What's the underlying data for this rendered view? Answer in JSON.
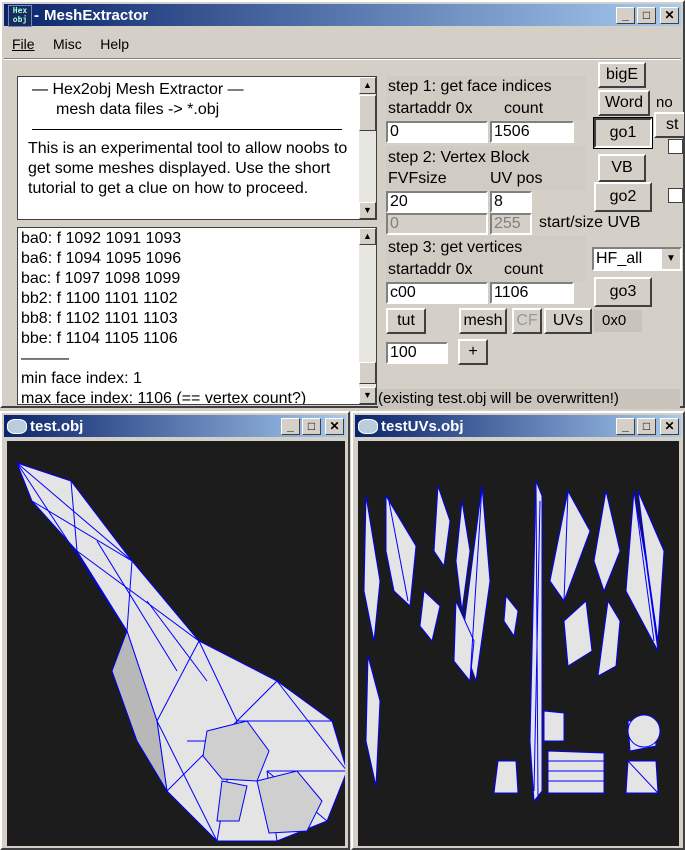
{
  "app": {
    "title": "MeshExtractor",
    "title_prefix": "- ",
    "icon_text_1": "Hex",
    "icon_text_2": "obj"
  },
  "menu": [
    "File",
    "Misc",
    "Help"
  ],
  "info": {
    "line1": "—   Hex2obj Mesh Extractor   —",
    "line2": "mesh data files -> *.obj",
    "para": "This is an experimental tool to allow noobs to get some meshes displayed. Use the short tutorial to get a clue on how to proceed."
  },
  "log": {
    "lines": [
      "ba0: f  1092 1091 1093",
      "ba6: f  1094 1095 1096",
      "bac: f  1097 1098 1099",
      "bb2: f  1100 1101 1102",
      "bb8: f  1102 1101 1103",
      "bbe: f  1104 1105 1106",
      "———",
      "min face index: 1",
      "max face index: 1106 (== vertex count?)"
    ]
  },
  "step1": {
    "title": "step 1: get face indices",
    "label_addr": "startaddr 0x",
    "label_count": "count",
    "addr": "0",
    "count": "1506",
    "button": "go1"
  },
  "step2": {
    "title": "step 2: Vertex Block",
    "label_fvf": "FVFsize",
    "label_uv": "UV pos",
    "fvf": "20",
    "uv": "8",
    "uvb_start": "0",
    "uvb_size": "255",
    "label_uvb": "start/size UVB",
    "button": "go2"
  },
  "step3": {
    "title": "step 3: get vertices",
    "label_addr": "startaddr 0x",
    "label_count": "count",
    "addr": "c00",
    "count": "1106",
    "button": "go3",
    "select": "HF_all"
  },
  "side": {
    "bigE": "bigE",
    "word": "Word",
    "vb": "VB",
    "partial1": "no",
    "partial2": "st"
  },
  "actions": {
    "tut": "tut",
    "mesh": "mesh",
    "cf": "CF",
    "uvs": "UVs",
    "dims": "0x0",
    "zoom": "100",
    "plus": "+",
    "note": "(existing test.obj will be overwritten!)"
  },
  "child1": {
    "title": "test.obj"
  },
  "child2": {
    "title": "testUVs.obj"
  },
  "colors": {
    "wire": "#0000ff",
    "mesh_fill": "#e4e4e4",
    "viewport_bg": "#1c1c1c",
    "title_start": "#0a246a",
    "title_end": "#a6caf0"
  }
}
